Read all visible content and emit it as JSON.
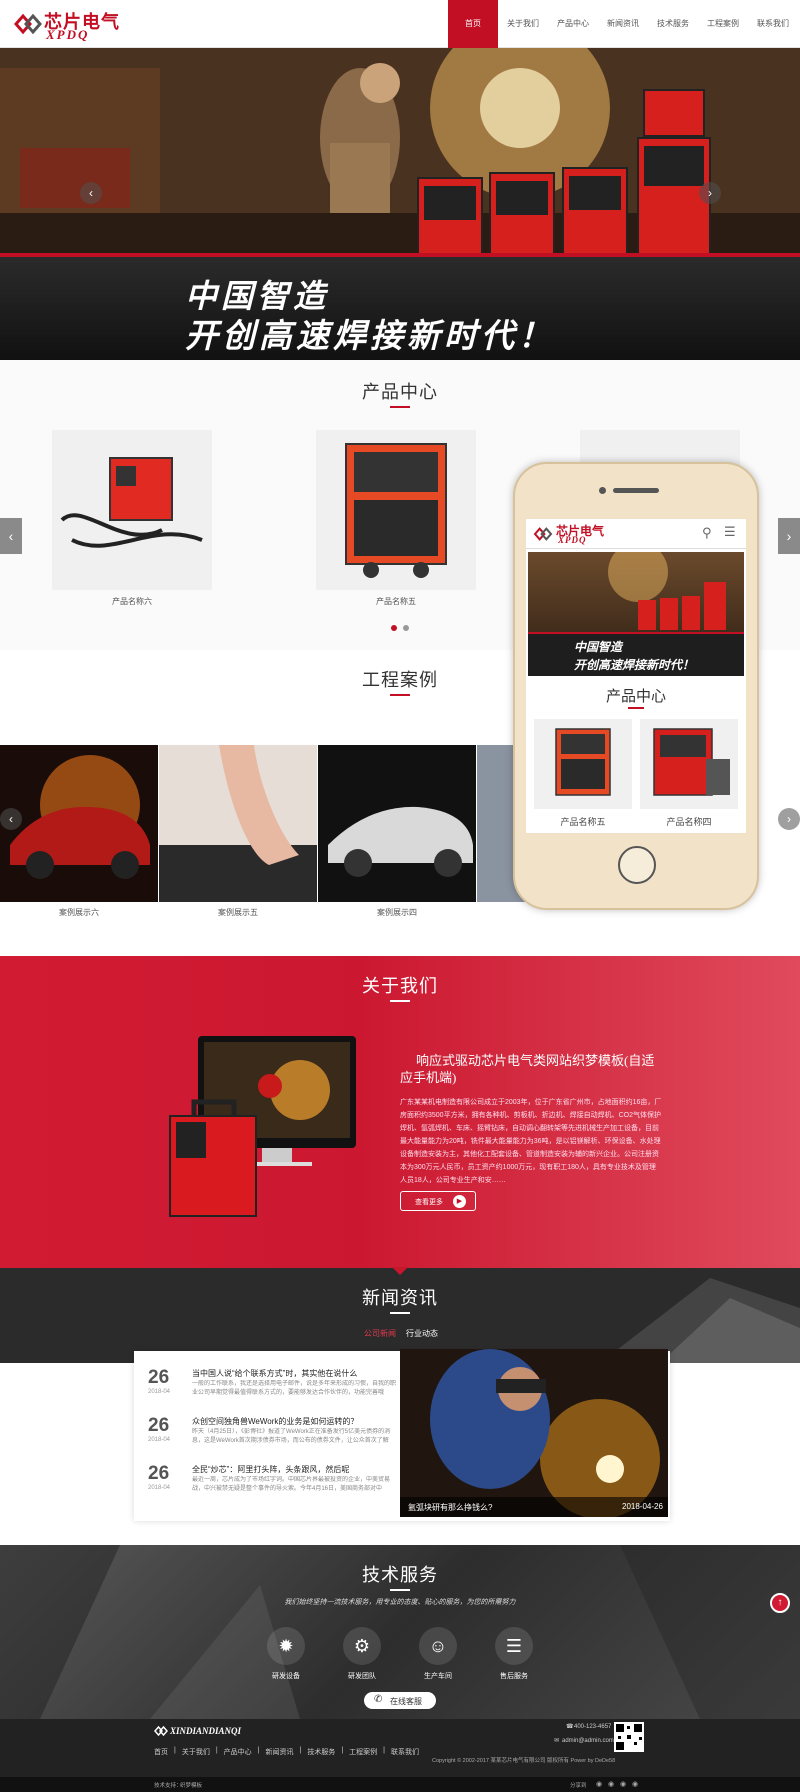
{
  "brand": {
    "logo_zh": "芯片电气",
    "logo_en": "XPDQ",
    "accent": "#c20f24"
  },
  "nav": {
    "items": [
      {
        "label": "首页",
        "active": true
      },
      {
        "label": "关于我们"
      },
      {
        "label": "产品中心"
      },
      {
        "label": "新闻资讯"
      },
      {
        "label": "技术服务"
      },
      {
        "label": "工程案例"
      },
      {
        "label": "联系我们"
      }
    ]
  },
  "banner": {
    "slogan_line1": "中国智造",
    "slogan_line2": "开创高速焊接新时代！"
  },
  "products": {
    "title": "产品中心",
    "items": [
      {
        "caption": "产品名称六"
      },
      {
        "caption": "产品名称五"
      }
    ]
  },
  "cases": {
    "title": "工程案例",
    "items": [
      {
        "caption": "案例展示六"
      },
      {
        "caption": "案例展示五"
      },
      {
        "caption": "案例展示四"
      }
    ]
  },
  "mobile": {
    "logo_zh": "芯片电气",
    "logo_en": "XPDQ",
    "slogan_line1": "中国智造",
    "slogan_line2": "开创高速焊接新时代！",
    "section_title": "产品中心",
    "items": [
      {
        "caption": "产品名称五"
      },
      {
        "caption": "产品名称四"
      }
    ]
  },
  "about": {
    "title": "关于我们",
    "heading": "响应式驱动芯片电气类网站织梦模板(自适应手机端)",
    "body": "广东某某机电制造有限公司成立于2003年，位于广东省广州市，占地面积约16亩，厂房面积约3500平方米，拥有各种机、剪板机、折边机、焊接自动焊机、CO2气体保护焊机、氩弧焊机、车床、摇臂钻床，自动调心翻转架等先进机械生产加工设备，目前最大能量能力为20吨，铣件最大能量能力为36吨，是以铝镁解析、环保设备、水处理设备制造安装为主，其他化工配套设备、管道制造安装为辅的新兴企业。公司注册资本为300万元人民币，员工资产约1000万元，现有职工180人，具有专业技术及管理人员18人，公司专业生产和安……",
    "more_label": "查看更多"
  },
  "news": {
    "title": "新闻资讯",
    "tabs": [
      {
        "label": "公司新闻",
        "active": true
      },
      {
        "label": "行业动态"
      }
    ],
    "items": [
      {
        "day": "26",
        "date": "2018-04",
        "title": "当中国人说“给个联系方式”时，其实他在说什么",
        "summary": "一般的工作联系，我还是选择用电子邮件，说是多年来形成的习惯，自我的职业公司早期觉得最值得联系方式的，要能够发达合作伙伴的，功能完善哦"
      },
      {
        "day": "26",
        "date": "2018-04",
        "title": "众创空间独角兽WeWork的业务是如何运转的？",
        "summary": "昨天（4月25日），《彭博社》报道了WeWork正在准备发行5亿美元债券的消息，这是WeWork首次期涉债券市场，而公布的债券文件，让公众首次了解"
      },
      {
        "day": "26",
        "date": "2018-04",
        "title": "全民“炒芯”：阿里打头阵，头条跟风，然后呢",
        "summary": "最近一周，芯片成为了市场红字词。中国芯片界最被投资的企业，中美贸易战，中兴被禁无疑是整个事件的导火索。今年4月16日，美国商务部对中"
      }
    ],
    "feature": {
      "caption": "氩弧块研有那么挣钱么?",
      "date": "2018-04-26"
    }
  },
  "tech": {
    "title": "技术服务",
    "subtitle": "我们始终坚持一流技术服务，用专业的态度、贴心的服务，为您的所需努力",
    "services": [
      {
        "label": "研发设备",
        "icon": "gear-cluster-icon"
      },
      {
        "label": "研发团队",
        "icon": "team-gear-icon"
      },
      {
        "label": "生产车间",
        "icon": "workers-icon"
      },
      {
        "label": "售后服务",
        "icon": "document-service-icon"
      }
    ],
    "online_label": "在线客服"
  },
  "footer": {
    "logo": "XINDIANDIANQI",
    "links": [
      "首页",
      "关于我们",
      "产品中心",
      "新闻资讯",
      "技术服务",
      "工程案例",
      "联系我们"
    ],
    "phone": "400-123-4657",
    "email": "admin@admin.com",
    "copyright": "Copyright © 2002-2017 某某芯片电气有限公司 版权所有 Power by DeDe58",
    "share_label": "分享到",
    "bottom_left": "技术支持：",
    "bottom_link": "织梦模板"
  }
}
